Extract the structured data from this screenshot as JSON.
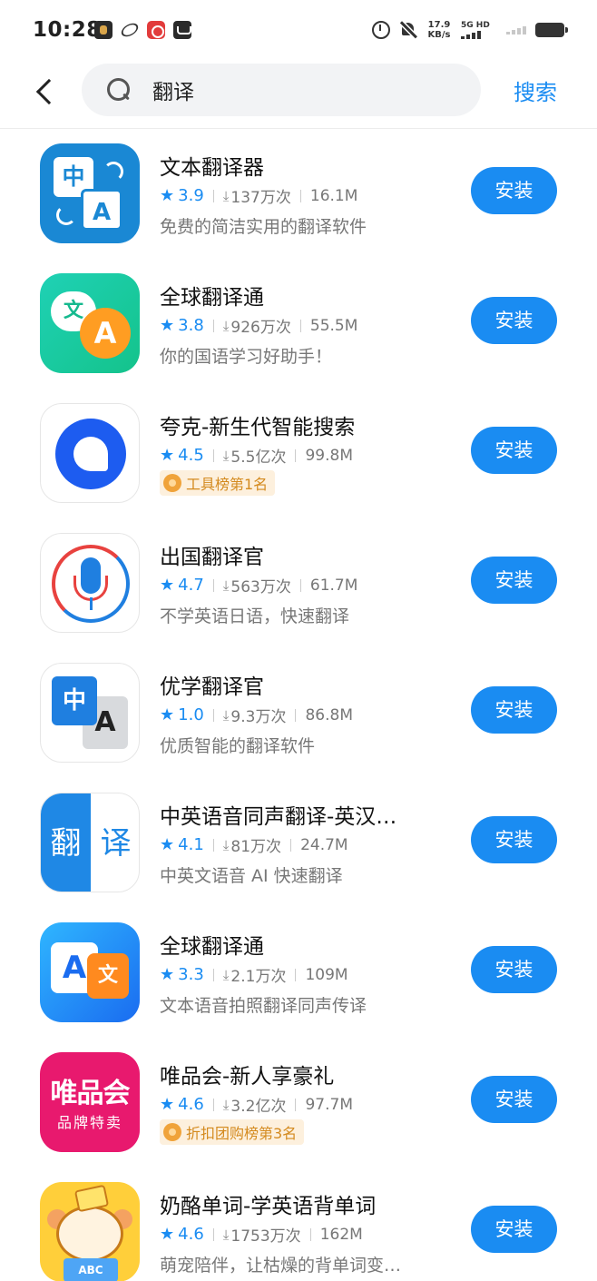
{
  "status_bar": {
    "time": "10:28",
    "speed_value": "17.9",
    "speed_unit": "KB/s",
    "network": "5G HD"
  },
  "search": {
    "query": "翻译",
    "button_label": "搜索"
  },
  "install_label": "安装",
  "apps": [
    {
      "name": "文本翻译器",
      "rating": "3.9",
      "downloads": "137万次",
      "size": "16.1M",
      "desc": "免费的简洁实用的翻译软件",
      "icon": "wenben-translator-icon"
    },
    {
      "name": "全球翻译通",
      "rating": "3.8",
      "downloads": "926万次",
      "size": "55.5M",
      "desc": "你的国语学习好助手！",
      "icon": "quanqiu-translator-icon"
    },
    {
      "name": "夸克-新生代智能搜索",
      "rating": "4.5",
      "downloads": "5.5亿次",
      "size": "99.8M",
      "badge": "工具榜第1名",
      "icon": "quark-icon"
    },
    {
      "name": "出国翻译官",
      "rating": "4.7",
      "downloads": "563万次",
      "size": "61.7M",
      "desc": "不学英语日语，快速翻译",
      "icon": "chuguo-translator-icon"
    },
    {
      "name": "优学翻译官",
      "rating": "1.0",
      "downloads": "9.3万次",
      "size": "86.8M",
      "desc": "优质智能的翻译软件",
      "icon": "youxue-translator-icon"
    },
    {
      "name": "中英语音同声翻译-英汉…",
      "rating": "4.1",
      "downloads": "81万次",
      "size": "24.7M",
      "desc": "中英文语音 AI 快速翻译",
      "icon": "zhongying-translator-icon"
    },
    {
      "name": "全球翻译通",
      "rating": "3.3",
      "downloads": "2.1万次",
      "size": "109M",
      "desc": "文本语音拍照翻译同声传译",
      "icon": "quanqiu-blue-translator-icon"
    },
    {
      "name": "唯品会-新人享豪礼",
      "rating": "4.6",
      "downloads": "3.2亿次",
      "size": "97.7M",
      "badge": "折扣团购榜第3名",
      "icon": "vipshop-icon"
    },
    {
      "name": "奶酪单词-学英语背单词",
      "rating": "4.6",
      "downloads": "1753万次",
      "size": "162M",
      "desc": "萌宠陪伴，让枯燥的背单词变…",
      "icon": "naolao-words-icon"
    }
  ],
  "icon_text": {
    "wenben_zh": "中",
    "wenben_a": "A",
    "quanqiu_wen": "文",
    "quanqiu_a": "A",
    "youxue_zh": "中",
    "youxue_a": "A",
    "zhongying_l": "翻",
    "zhongying_r": "译",
    "quanqiu2_a": "A",
    "quanqiu2_wen": "文",
    "weipin_t1": "唯品会",
    "weipin_t2": "品牌特卖",
    "naolao_book": "ABC"
  }
}
